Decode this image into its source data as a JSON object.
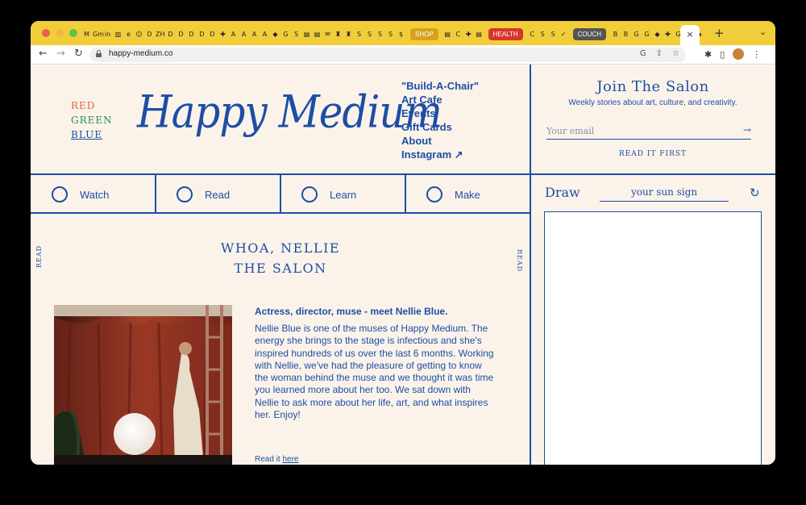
{
  "browser": {
    "tab_favicons": [
      "M",
      "Gm",
      "in",
      "▥",
      "e",
      "☺",
      "D",
      "ZH",
      "D",
      "D",
      "D",
      "D",
      "D",
      "✚",
      "A",
      "A",
      "A",
      "A",
      "◆",
      "G",
      "S",
      "▤",
      "▤",
      "✉",
      "♜",
      "♜",
      "S",
      "S",
      "S",
      "S",
      "$"
    ],
    "tab_pills": [
      {
        "label": "SHOP",
        "color": "#d6a21e"
      },
      {
        "label": "HEALTH",
        "color": "#d8352a"
      },
      {
        "label": "COUCH",
        "color": "#555555"
      }
    ],
    "tab_favicons_mid": [
      "▤",
      "C",
      "✚",
      "▤"
    ],
    "tab_favicons_mid2": [
      "C",
      "S",
      "S",
      "✓"
    ],
    "tab_favicons_end": [
      "B",
      "B",
      "G",
      "G",
      "◆",
      "✚",
      "G",
      "▧",
      "◆"
    ],
    "active_tab_close": "×",
    "new_tab": "+",
    "tab_menu": "⌄",
    "url": "happy-medium.co",
    "omnibox_icons": [
      "G",
      "⇪",
      "☆"
    ],
    "toolbar_icons": [
      "✱",
      "▯",
      "⋮"
    ]
  },
  "header": {
    "rgb": [
      "RED",
      "GREEN",
      "BLUE"
    ],
    "rgb_colors": [
      "#e2643b",
      "#2f8a4d",
      "#1d4ea5"
    ],
    "logo": "Happy Medium",
    "nav": [
      "\"Build-A-Chair\"",
      "Art Cafe",
      "Events",
      "Gift Cards",
      "About",
      "Instagram ↗"
    ]
  },
  "salon": {
    "title": "Join The Salon",
    "subtitle": "Weekly stories about art, culture, and creativity.",
    "email_placeholder": "Your email",
    "submit_arrow": "→",
    "cta": "READ IT FIRST"
  },
  "categories": [
    "Watch",
    "Read",
    "Learn",
    "Make"
  ],
  "draw": {
    "label": "Draw",
    "prompt": "your sun sign",
    "refresh": "↻"
  },
  "article": {
    "side_label": "READ",
    "heading_line1": "WHOA, NELLIE",
    "heading_line2": "THE SALON",
    "title": "Actress, director, muse - meet Nellie Blue.",
    "body": "Nellie Blue is one of the muses of Happy Medium. The energy she brings to the stage is infectious and she's inspired hundreds of us over the last 6 months. Working with Nellie, we've had the pleasure of getting to know the woman behind the muse and we thought it was time you learned more about her too. We sat down with Nellie to ask more about her life, art, and what inspires her. Enjoy!",
    "read_prefix": "Read it ",
    "read_link": "here"
  }
}
